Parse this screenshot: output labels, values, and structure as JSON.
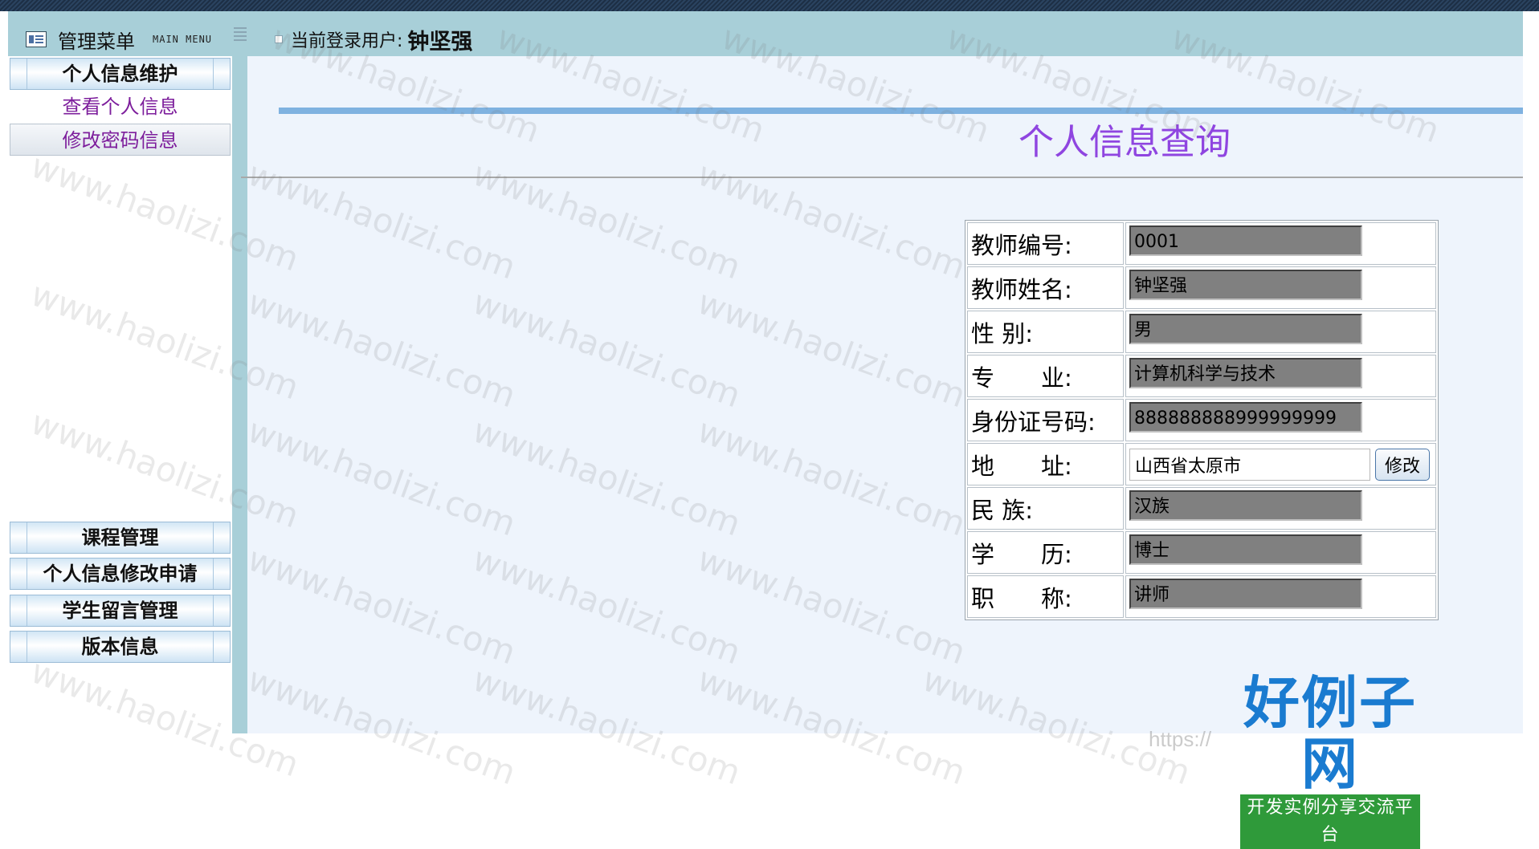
{
  "header": {
    "menu_title": "管理菜单",
    "menu_subtitle": "MAIN MENU",
    "current_user_label": "当前登录用户:",
    "current_user_name": "钟坚强"
  },
  "sidebar": {
    "top_section": {
      "label": "个人信息维护",
      "items": [
        "查看个人信息",
        "修改密码信息"
      ]
    },
    "bottom_sections": [
      "课程管理",
      "个人信息修改申请",
      "学生留言管理",
      "版本信息"
    ]
  },
  "main": {
    "title": "个人信息查询",
    "fields": [
      {
        "label": "教师编号:",
        "value": "0001"
      },
      {
        "label": "教师姓名:",
        "value": "钟坚强"
      },
      {
        "label": "性 别:",
        "value": "男"
      },
      {
        "label": "专　　业:",
        "value": "计算机科学与技术"
      },
      {
        "label": "身份证号码:",
        "value": "888888888999999999"
      },
      {
        "label": "地　　址:",
        "value": "山西省太原市"
      },
      {
        "label": "民 族:",
        "value": "汉族"
      },
      {
        "label": "学　　历:",
        "value": "博士"
      },
      {
        "label": "职　　称:",
        "value": "讲师"
      }
    ],
    "modify_button": "修改"
  },
  "watermark": {
    "text": "www.haolizi.com",
    "logo_title": "好例子网",
    "logo_subtitle": "开发实例分享交流平台",
    "url_fragment": "https://"
  },
  "colors": {
    "frame": "#a8cfd8",
    "content_bg": "#eef4fc",
    "title_purple": "#8f45e0",
    "link_purple": "#7d1e9c",
    "accent_blue_bar": "#7fb2e0",
    "readonly_gray": "#808080"
  }
}
